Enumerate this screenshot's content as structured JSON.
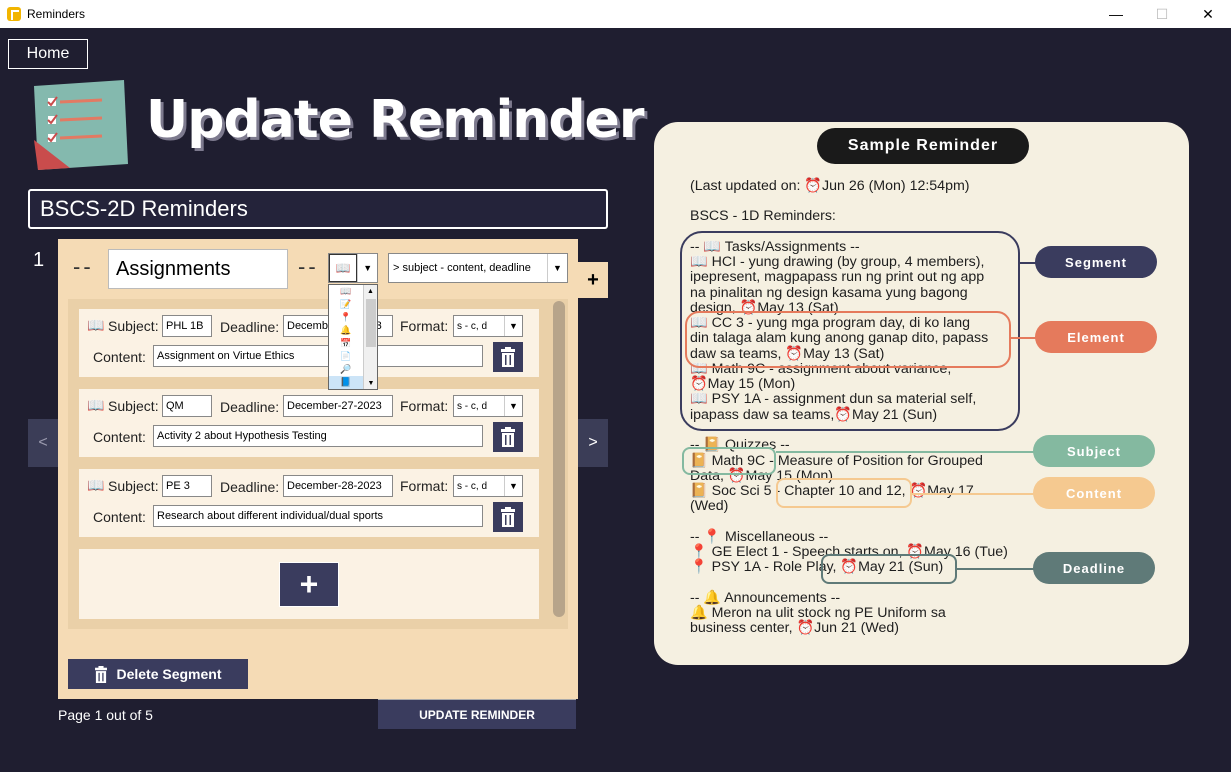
{
  "window": {
    "title": "Reminders",
    "minimize": "—",
    "maximize": "☐",
    "close": "✕"
  },
  "home_label": "Home",
  "page_title": "Update Reminder",
  "reminder_name": "BSCS-2D Reminders",
  "segment": {
    "number": "1",
    "dashes": "--",
    "name": "Assignments",
    "icon": "📖",
    "format": "> subject - content, deadline",
    "add": "+",
    "icon_options": [
      "📖",
      "📝",
      "📍",
      "🔔",
      "📅",
      "📄",
      "🔎",
      "📘"
    ]
  },
  "labels": {
    "subject": "Subject:",
    "deadline": "Deadline:",
    "format": "Format:",
    "content": "Content:"
  },
  "elements": [
    {
      "subject": "PHL 1B",
      "deadline": "December-27-2023",
      "format": "s - c, d",
      "content": "Assignment on Virtue Ethics"
    },
    {
      "subject": "QM",
      "deadline": "December-27-2023",
      "format": "s - c, d",
      "content": "Activity 2 about Hypothesis Testing"
    },
    {
      "subject": "PE 3",
      "deadline": "December-28-2023",
      "format": "s - c, d",
      "content": "Research about different individual/dual sports"
    }
  ],
  "add_element": "+",
  "nav": {
    "prev": "<",
    "next": ">"
  },
  "delete_segment": "Delete Segment",
  "page_info": "Page 1 out of 5",
  "update_button": "UPDATE REMINDER",
  "sample": {
    "title": "Sample Reminder",
    "lines": [
      "(Last updated on: ⏰Jun 26 (Mon) 12:54pm)",
      "BSCS - 1D Reminders:",
      "-- 📖 Tasks/Assignments --",
      "📖 HCI - yung drawing (by group, 4 members),",
      "ipepresent, magpapass run ng print out ng app",
      "na pinalitan ng design kasama yung bagong",
      "design, ⏰May 13 (Sat)",
      "📖 CC 3 - yung mga program day, di ko lang",
      "din talaga alam kung anong ganap dito, papass",
      "daw sa teams, ⏰May 13 (Sat)",
      "📖 Math 9C - assignment about variance,",
      "⏰May 15 (Mon)",
      "📖 PSY 1A - assignment dun sa material self,",
      "ipapass daw sa teams,⏰May 21 (Sun)",
      "-- 📔 Quizzes --",
      "📔 Math 9C - Measure of Position for Grouped",
      "Data, ⏰May 15 (Mon)",
      "📔 Soc Sci 5 - Chapter 10 and 12, ⏰May 17",
      "(Wed)",
      "-- 📍 Miscellaneous --",
      "📍 GE Elect 1 - Speech starts on, ⏰May 16 (Tue)",
      "📍 PSY 1A - Role Play, ⏰May 21 (Sun)",
      "-- 🔔 Announcements --",
      "🔔 Meron na ulit stock ng PE Uniform sa",
      "business center, ⏰Jun 21 (Wed)"
    ],
    "legend": [
      "Segment",
      "Element",
      "Subject",
      "Content",
      "Deadline"
    ],
    "colors": {
      "segment": "#3a3c5e",
      "element": "#e57a5c",
      "subject": "#84b9a0",
      "content": "#f5c990",
      "deadline": "#5f7a78"
    }
  }
}
